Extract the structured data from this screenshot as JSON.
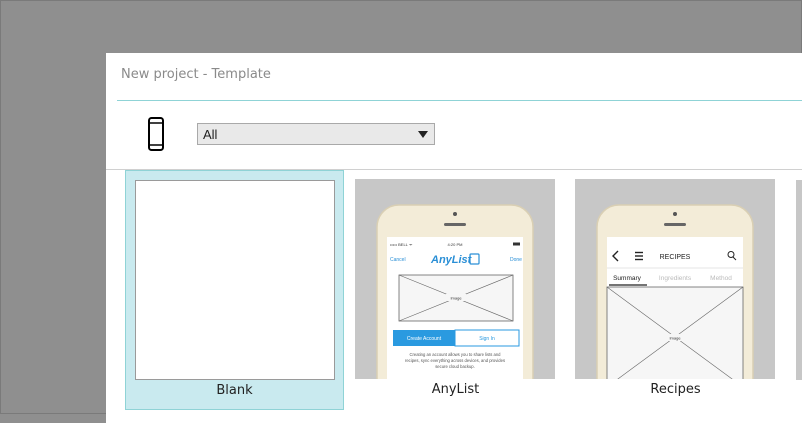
{
  "dialog": {
    "title": "New project - Template",
    "filter": {
      "selected": "All"
    }
  },
  "templates": [
    {
      "label": "Blank"
    },
    {
      "label": "AnyList",
      "preview": {
        "status_left": "••••• BELL ᯤ",
        "status_time": "4:20 PM",
        "cancel": "Cancel",
        "brand": "AnyList",
        "done": "Done",
        "image": "Image",
        "create_account": "Create Account",
        "sign_in": "Sign In",
        "body": [
          "Creating an account allows you to share lists and",
          "recipes, sync everything across devices, and provides",
          "secure cloud backup."
        ]
      }
    },
    {
      "label": "Recipes",
      "preview": {
        "title": "RECIPES",
        "tabs": [
          "Summary",
          "Ingredients",
          "Method"
        ],
        "image": "Image"
      }
    }
  ],
  "colors": {
    "accent": "#8fd3d6",
    "selected_bg": "#c9eaef",
    "backdrop": "#8f8f8f"
  }
}
